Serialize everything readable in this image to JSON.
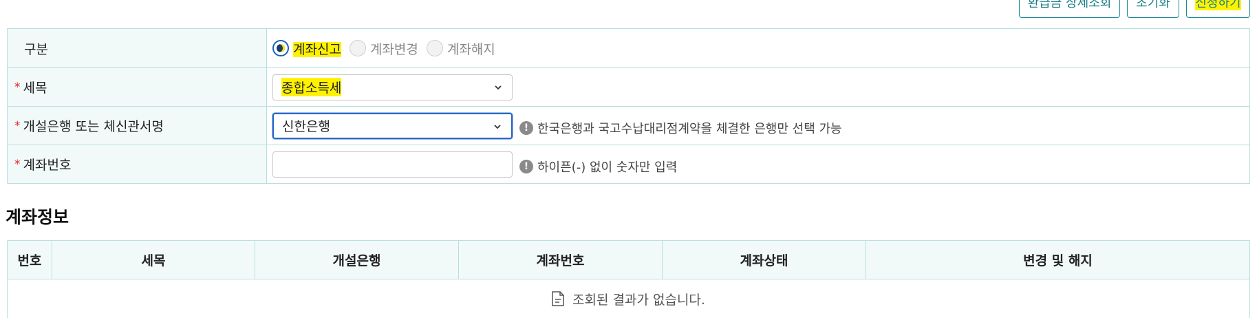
{
  "toolbar": {
    "refund_label": "환급금 상세조회",
    "reset_label": "초기화",
    "apply_label": "신청하기"
  },
  "form": {
    "type": {
      "label": "구분",
      "options": [
        {
          "label": "계좌신고",
          "selected": true
        },
        {
          "label": "계좌변경",
          "selected": false
        },
        {
          "label": "계좌해지",
          "selected": false
        }
      ]
    },
    "tax_item": {
      "required_mark": "*",
      "label": "세목",
      "value": "종합소득세"
    },
    "bank": {
      "required_mark": "*",
      "label": "개설은행 또는 체신관서명",
      "value": "신한은행",
      "hint": "한국은행과 국고수납대리점계약을 체결한 은행만 선택 가능"
    },
    "account": {
      "required_mark": "*",
      "label": "계좌번호",
      "value": "",
      "hint": "하이픈(-) 없이 숫자만 입력"
    }
  },
  "hint_icon_glyph": "!",
  "section_title": "계좌정보",
  "table": {
    "columns": [
      "번호",
      "세목",
      "개설은행",
      "계좌번호",
      "계좌상태",
      "변경 및 해지"
    ],
    "empty_message": "조회된 결과가 없습니다."
  },
  "colors": {
    "accent": "#1a8c98",
    "highlight": "#fff200",
    "required": "#e8282b",
    "label_bg": "#f1faf9",
    "border": "#b9dedf"
  }
}
